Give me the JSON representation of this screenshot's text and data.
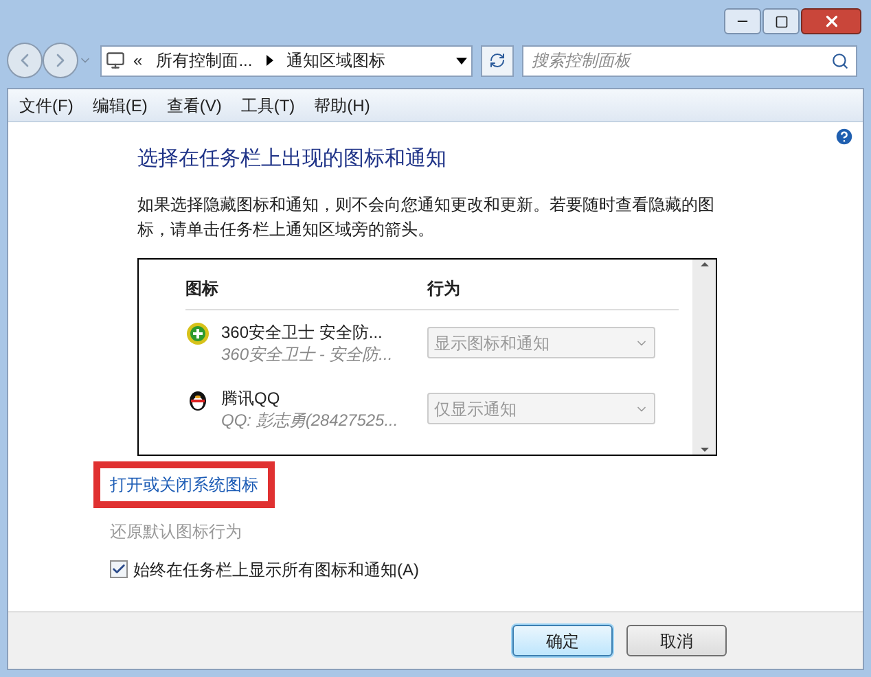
{
  "address_bar": {
    "overflow": "«",
    "crumbs": [
      "所有控制面...",
      "通知区域图标"
    ]
  },
  "search": {
    "placeholder": "搜索控制面板"
  },
  "menu": [
    "文件(F)",
    "编辑(E)",
    "查看(V)",
    "工具(T)",
    "帮助(H)"
  ],
  "heading": "选择在任务栏上出现的图标和通知",
  "description": "如果选择隐藏图标和通知，则不会向您通知更改和更新。若要随时查看隐藏的图标，请单击任务栏上通知区域旁的箭头。",
  "table": {
    "columns": [
      "图标",
      "行为"
    ],
    "rows": [
      {
        "kind": "shield",
        "name": "360安全卫士 安全防...",
        "detail": "360安全卫士 - 安全防...",
        "behavior": "显示图标和通知",
        "disabled": true
      },
      {
        "kind": "penguin",
        "name": "腾讯QQ",
        "detail": "QQ: 彭志勇(28427525...",
        "behavior": "仅显示通知",
        "disabled": true
      }
    ]
  },
  "links": [
    {
      "text": "打开或关闭系统图标",
      "disabled": false,
      "highlighted": true
    },
    {
      "text": "还原默认图标行为",
      "disabled": true,
      "highlighted": false
    }
  ],
  "always_show": {
    "label": "始终在任务栏上显示所有图标和通知(A)",
    "checked": true
  },
  "buttons": [
    {
      "label": "确定",
      "default": true
    },
    {
      "label": "取消",
      "default": false
    }
  ]
}
